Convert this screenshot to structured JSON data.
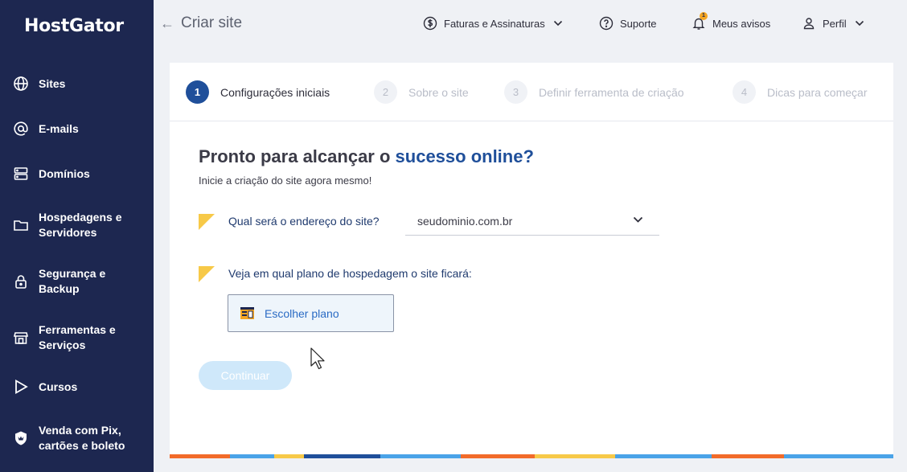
{
  "app": {
    "logo": "HostGator"
  },
  "sidebar": {
    "items": [
      {
        "label": "Sites",
        "icon": "globe-icon"
      },
      {
        "label": "E-mails",
        "icon": "at-icon"
      },
      {
        "label": "Domínios",
        "icon": "server-icon"
      },
      {
        "label": "Hospedagens e Servidores",
        "icon": "folder-icon"
      },
      {
        "label": "Segurança e Backup",
        "icon": "lock-icon"
      },
      {
        "label": "Ferramentas e Serviços",
        "icon": "store-icon"
      },
      {
        "label": "Cursos",
        "icon": "play-icon"
      },
      {
        "label": "Venda com Pix, cartões e boleto",
        "icon": "shield-icon"
      }
    ]
  },
  "header": {
    "back_arrow": "←",
    "title": "Criar site",
    "billing": "Faturas e Assinaturas",
    "support": "Suporte",
    "notices": "Meus avisos",
    "notices_badge": "1",
    "profile": "Perfil"
  },
  "stepper": {
    "steps": [
      {
        "num": "1",
        "label": "Configurações iniciais",
        "active": true
      },
      {
        "num": "2",
        "label": "Sobre o site",
        "active": false
      },
      {
        "num": "3",
        "label": "Definir ferramenta de criação",
        "active": false
      },
      {
        "num": "4",
        "label": "Dicas para começar",
        "active": false
      }
    ]
  },
  "main": {
    "headline_prefix": "Pronto para alcançar o ",
    "headline_highlight": "sucesso online?",
    "subtitle": "Inicie a criação do site agora mesmo!",
    "question_domain": "Qual será o endereço do site?",
    "domain_value": "seudominio.com.br",
    "question_plan": "Veja em qual plano de hospedagem o site ficará:",
    "choose_plan": "Escolher plano",
    "continue": "Continuar"
  },
  "colors": {
    "sidebar_bg": "#1d2750",
    "accent_blue": "#1f4f9a",
    "link_blue": "#2a6bc4",
    "flag_yellow": "#f7c948",
    "stripe": [
      "#f26b2a",
      "#4aa3e8",
      "#f7c948",
      "#1f4f9a",
      "#4aa3e8",
      "#f26b2a",
      "#f7c948",
      "#4aa3e8",
      "#f26b2a",
      "#4aa3e8"
    ]
  }
}
